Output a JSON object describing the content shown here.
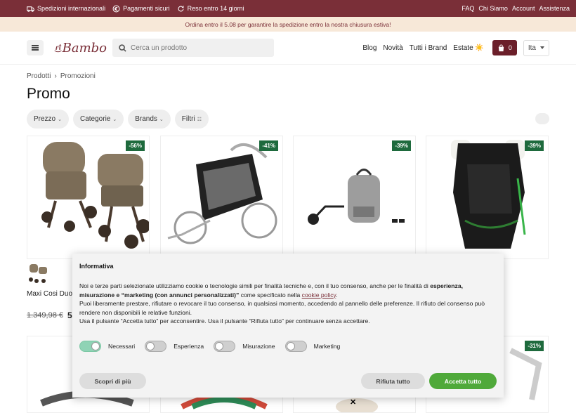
{
  "topbar": {
    "shipping": "Spedizioni internazionali",
    "payments": "Pagamenti sicuri",
    "returns": "Reso entro 14 giorni",
    "links": [
      "FAQ",
      "Chi Siamo",
      "Account",
      "Assistenza"
    ]
  },
  "notice": "Ordina entro il 5.08 per garantire la spedizione entro la nostra chiusura estiva!",
  "header": {
    "logo_text": "Bambo",
    "search_placeholder": "Cerca un prodotto",
    "nav": [
      "Blog",
      "Novità",
      "Tutti i Brand",
      "Estate ☀️"
    ],
    "cart_count": "0",
    "language": "Ita"
  },
  "breadcrumb": [
    "Prodotti",
    "Promozioni"
  ],
  "page_title": "Promo",
  "filters": [
    "Prezzo",
    "Categorie",
    "Brands",
    "Filtri"
  ],
  "products": [
    {
      "badge": "-56%",
      "name": "Maxi Cosi Duo",
      "price_old": "1.349,98 €",
      "price_new": "5"
    },
    {
      "badge": "-41%"
    },
    {
      "badge": "-39%"
    },
    {
      "badge": "-39%"
    }
  ],
  "row2_badge": "-31%",
  "cookie": {
    "title": "Informativa",
    "p1_start": "Noi e terze parti selezionate utilizziamo cookie o tecnologie simili per finalità tecniche e, con il tuo consenso, anche per le finalità di ",
    "p1_bold": "esperienza, misurazione e “marketing (con annunci personalizzati)”",
    "p1_mid": " come specificato nella ",
    "p1_link": "cookie policy",
    "p1_end": ".",
    "p2": "Puoi liberamente prestare, rifiutare o revocare il tuo consenso, in qualsiasi momento, accedendo al pannello delle preferenze. Il rifiuto del consenso può rendere non disponibili le relative funzioni.",
    "p3": "Usa il pulsante “Accetta tutto” per acconsentire. Usa il pulsante “Rifiuta tutto” per continuare senza accettare.",
    "switches": [
      "Necessari",
      "Esperienza",
      "Misurazione",
      "Marketing"
    ],
    "learn_more": "Scopri di più",
    "reject_all": "Rifiuta tutto",
    "accept_all": "Accetta tutto"
  }
}
